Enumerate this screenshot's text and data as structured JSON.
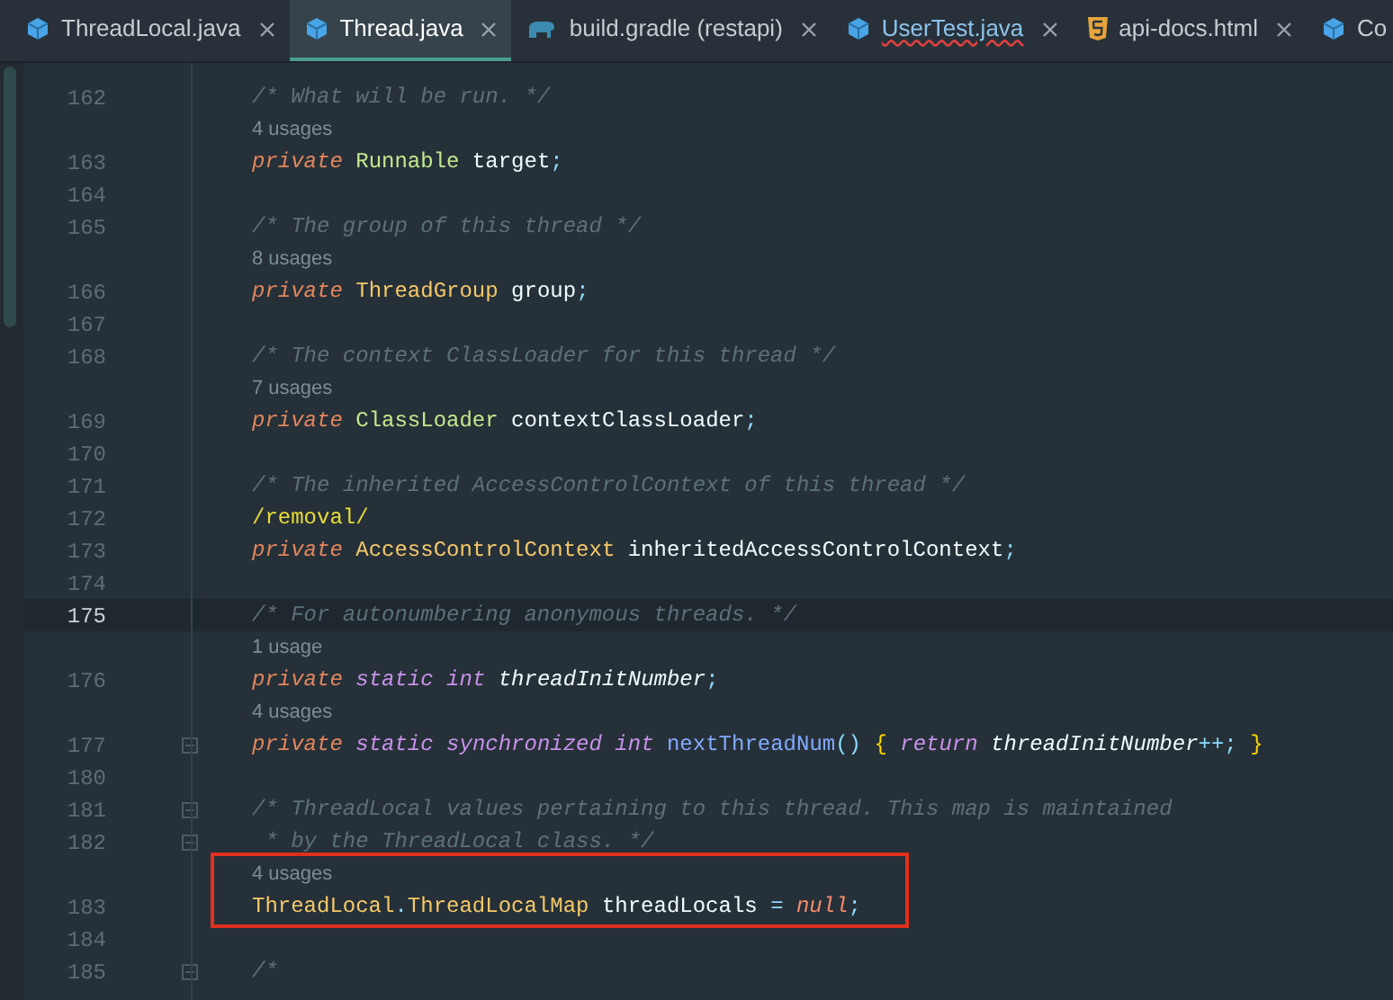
{
  "tabs": [
    {
      "label": "ThreadLocal.java",
      "kind": "java",
      "selected": false,
      "error": false,
      "closable": true
    },
    {
      "label": "Thread.java",
      "kind": "java",
      "selected": true,
      "error": false,
      "closable": true
    },
    {
      "label": "build.gradle (restapi)",
      "kind": "gradle",
      "selected": false,
      "error": false,
      "closable": true
    },
    {
      "label": "UserTest.java",
      "kind": "java",
      "selected": false,
      "error": true,
      "closable": true
    },
    {
      "label": "api-docs.html",
      "kind": "html",
      "selected": false,
      "error": false,
      "closable": true
    },
    {
      "label": "Co",
      "kind": "java",
      "selected": false,
      "error": false,
      "closable": false
    }
  ],
  "lines": [
    {
      "kind": "code",
      "number": "162",
      "tokens": [
        {
          "t": "/* What will be run. */",
          "kind": "comment"
        }
      ]
    },
    {
      "kind": "usage",
      "text": "4 usages"
    },
    {
      "kind": "code",
      "number": "163",
      "tokens": [
        {
          "t": "private",
          "kind": "keyword"
        },
        {
          "t": " Runnable",
          "kind": "type-green"
        },
        {
          "t": " target",
          "kind": "ident"
        },
        {
          "t": ";",
          "kind": "punct"
        }
      ]
    },
    {
      "kind": "code",
      "number": "164"
    },
    {
      "kind": "code",
      "number": "165",
      "tokens": [
        {
          "t": "/* The group of this thread */",
          "kind": "comment"
        }
      ]
    },
    {
      "kind": "usage",
      "text": "8 usages"
    },
    {
      "kind": "code",
      "number": "166",
      "tokens": [
        {
          "t": "private",
          "kind": "keyword"
        },
        {
          "t": " ThreadGroup",
          "kind": "type"
        },
        {
          "t": " group",
          "kind": "ident"
        },
        {
          "t": ";",
          "kind": "punct"
        }
      ]
    },
    {
      "kind": "code",
      "number": "167"
    },
    {
      "kind": "code",
      "number": "168",
      "tokens": [
        {
          "t": "/* The context ClassLoader for this thread */",
          "kind": "comment"
        }
      ]
    },
    {
      "kind": "usage",
      "text": "7 usages"
    },
    {
      "kind": "code",
      "number": "169",
      "tokens": [
        {
          "t": "private",
          "kind": "keyword"
        },
        {
          "t": " ClassLoader",
          "kind": "type-green"
        },
        {
          "t": " contextClassLoader",
          "kind": "ident"
        },
        {
          "t": ";",
          "kind": "punct"
        }
      ]
    },
    {
      "kind": "code",
      "number": "170"
    },
    {
      "kind": "code",
      "number": "171",
      "tokens": [
        {
          "t": "/* The inherited AccessControlContext of this thread */",
          "kind": "comment"
        }
      ]
    },
    {
      "kind": "code",
      "number": "172",
      "tokens": [
        {
          "t": "/removal/",
          "kind": "annotation"
        }
      ]
    },
    {
      "kind": "code",
      "number": "173",
      "tokens": [
        {
          "t": "private",
          "kind": "keyword"
        },
        {
          "t": " AccessControlContext",
          "kind": "type"
        },
        {
          "t": " inheritedAccessControlContext",
          "kind": "ident"
        },
        {
          "t": ";",
          "kind": "punct"
        }
      ]
    },
    {
      "kind": "code",
      "number": "174"
    },
    {
      "kind": "code",
      "number": "175",
      "current": true,
      "tokens": [
        {
          "t": "/* For autonumbering anonymous threads. */",
          "kind": "comment"
        }
      ]
    },
    {
      "kind": "usage",
      "text": "1 usage"
    },
    {
      "kind": "code",
      "number": "176",
      "tokens": [
        {
          "t": "private",
          "kind": "keyword"
        },
        {
          "t": " static",
          "kind": "modifier"
        },
        {
          "t": " int",
          "kind": "modifier"
        },
        {
          "t": " threadInitNumber",
          "kind": "static-ident"
        },
        {
          "t": ";",
          "kind": "punct"
        }
      ]
    },
    {
      "kind": "usage",
      "text": "4 usages"
    },
    {
      "kind": "code",
      "number": "177",
      "fold": true,
      "tokens": [
        {
          "t": "private",
          "kind": "keyword"
        },
        {
          "t": " static",
          "kind": "modifier"
        },
        {
          "t": " synchronized",
          "kind": "modifier"
        },
        {
          "t": " int",
          "kind": "modifier"
        },
        {
          "t": " nextThreadNum",
          "kind": "method"
        },
        {
          "t": "()",
          "kind": "punct"
        },
        {
          "t": " {",
          "kind": "brace"
        },
        {
          "t": " return",
          "kind": "modifier"
        },
        {
          "t": " threadInitNumber",
          "kind": "static-ident"
        },
        {
          "t": "++;",
          "kind": "punct"
        },
        {
          "t": " }",
          "kind": "brace"
        }
      ]
    },
    {
      "kind": "code",
      "number": "180"
    },
    {
      "kind": "code",
      "number": "181",
      "fold": true,
      "tokens": [
        {
          "t": "/* ThreadLocal values pertaining to this thread. This map is maintained",
          "kind": "comment"
        }
      ]
    },
    {
      "kind": "code",
      "number": "182",
      "fold": true,
      "tokens": [
        {
          "t": " * by the ThreadLocal class. */",
          "kind": "comment"
        }
      ]
    },
    {
      "kind": "usage",
      "text": "4 usages",
      "boxed": true
    },
    {
      "kind": "code",
      "number": "183",
      "boxed": true,
      "tokens": [
        {
          "t": "ThreadLocal",
          "kind": "type"
        },
        {
          "t": ".",
          "kind": "punct"
        },
        {
          "t": "ThreadLocalMap",
          "kind": "type"
        },
        {
          "t": " threadLocals",
          "kind": "ident"
        },
        {
          "t": " =",
          "kind": "punct"
        },
        {
          "t": " null",
          "kind": "literal"
        },
        {
          "t": ";",
          "kind": "punct"
        }
      ]
    },
    {
      "kind": "code",
      "number": "184"
    },
    {
      "kind": "code",
      "number": "185",
      "fold": true,
      "tokens": [
        {
          "t": "/*",
          "kind": "comment"
        }
      ]
    }
  ]
}
